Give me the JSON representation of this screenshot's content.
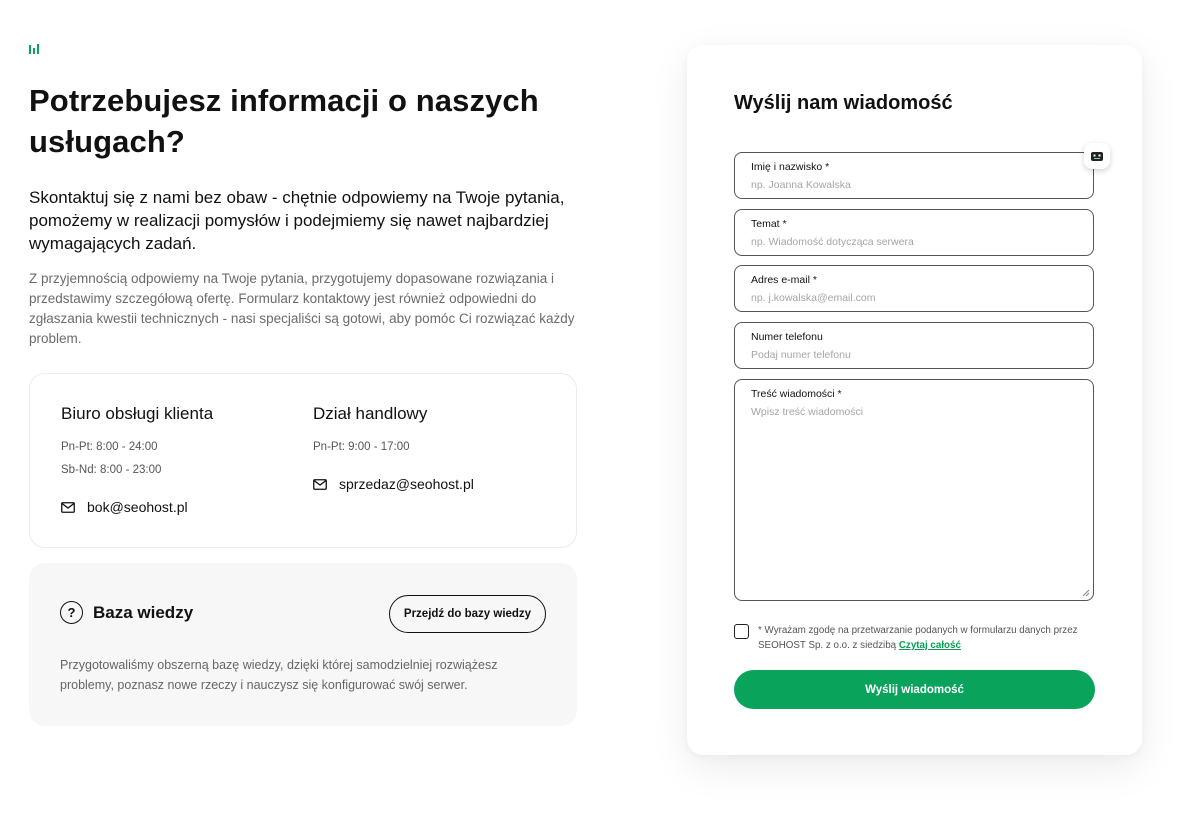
{
  "headline": "Potrzebujesz informacji o naszych usługach?",
  "lead": "Skontaktuj się z nami bez obaw - chętnie odpowiemy na Twoje pytania, pomożemy w realizacji pomysłów i podejmiemy się nawet najbardziej wymagających zadań.",
  "description": "Z przyjemnością odpowiemy na Twoje pytania, przygotujemy dopasowane rozwiązania i przedstawimy szczegółową ofertę. Formularz kontaktowy jest również odpowiedni do zgłaszania kwestii technicznych - nasi specjaliści są gotowi, aby pomóc Ci rozwiązać każdy problem.",
  "contact": {
    "support": {
      "title": "Biuro obsługi klienta",
      "hours_weekday": "Pn-Pt: 8:00 - 24:00",
      "hours_weekend": "Sb-Nd: 8:00 - 23:00",
      "email": "bok@seohost.pl"
    },
    "sales": {
      "title": "Dział handlowy",
      "hours_weekday": "Pn-Pt: 9:00 - 17:00",
      "email": "sprzedaz@seohost.pl"
    }
  },
  "knowledge_base": {
    "title": "Baza wiedzy",
    "icon": "question-icon",
    "button_label": "Przejdź do bazy wiedzy",
    "text": "Przygotowaliśmy obszerną bazę wiedzy, dzięki której samodzielniej rozwiążesz problemy, poznasz nowe rzeczy i nauczysz się konfigurować swój serwer."
  },
  "form": {
    "title": "Wyślij nam wiadomość",
    "fields": {
      "name": {
        "label": "Imię i nazwisko *",
        "placeholder": "np. Joanna Kowalska",
        "value": ""
      },
      "subject": {
        "label": "Temat *",
        "placeholder": "np. Wiadomość dotycząca serwera",
        "value": ""
      },
      "email": {
        "label": "Adres e-mail *",
        "placeholder": "np. j.kowalska@email.com",
        "value": ""
      },
      "phone": {
        "label": "Numer telefonu",
        "placeholder": "Podaj numer telefonu",
        "value": ""
      },
      "message": {
        "label": "Treść wiadomości *",
        "placeholder": "Wpisz treść wiadomości",
        "value": ""
      }
    },
    "consent_text": "* Wyrażam zgodę na przetwarzanie podanych w formularzu danych przez SEOHOST Sp. z o.o. z siedzibą",
    "consent_link": "Czytaj całość",
    "consent_checked": false,
    "submit_label": "Wyślij wiadomość"
  },
  "colors": {
    "accent": "#0aa35c",
    "link": "#0a9a55",
    "text": "#111111",
    "muted": "#6b6b6b"
  }
}
